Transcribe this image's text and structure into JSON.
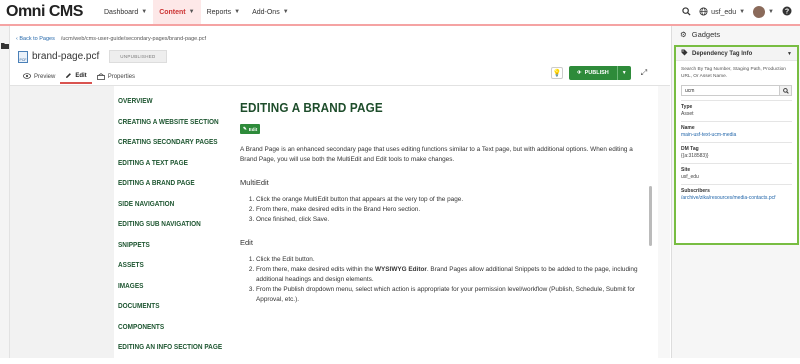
{
  "app": {
    "logo": "Omni CMS"
  },
  "nav": [
    {
      "label": "Dashboard",
      "active": false
    },
    {
      "label": "Content",
      "active": true
    },
    {
      "label": "Reports",
      "active": false
    },
    {
      "label": "Add-Ons",
      "active": false
    }
  ],
  "topright": {
    "site": "usf_edu"
  },
  "breadcrumb": {
    "back": "Back to Pages",
    "path": "/ucm/web/cms-user-guide/secondary-pages/brand-page.pcf"
  },
  "file": {
    "icon_text": "PCF",
    "name": "brand-page.pcf",
    "status": "UNPUBLISHED"
  },
  "tabs": [
    {
      "label": "Preview",
      "icon": "eye-icon"
    },
    {
      "label": "Edit",
      "icon": "pencil-icon"
    },
    {
      "label": "Properties",
      "icon": "properties-icon"
    }
  ],
  "toolbar": {
    "publish": "PUBLISH"
  },
  "sidenav": [
    "Overview",
    "Creating a Website Section",
    "Creating Secondary Pages",
    "Editing a Text Page",
    "Editing a Brand Page",
    "Side Navigation",
    "Editing Sub Navigation",
    "Snippets",
    "Assets",
    "Images",
    "Documents",
    "Components",
    "Editing an Info Section Page"
  ],
  "content": {
    "title": "EDITING A BRAND PAGE",
    "edit_button": "Edit",
    "intro": "A Brand Page is an enhanced secondary page that uses editing functions similar to a Text page, but with additional options. When editing a Brand Page, you will use both the MultiEdit and Edit tools to make changes.",
    "s1_title": "MultiEdit",
    "s1_items": [
      "Click the orange MultiEdit button that appears at the very top of the page.",
      "From there, make desired edits in the Brand Hero section.",
      "Once finished, click Save."
    ],
    "s2_title": "Edit",
    "s2_item1": "Click the Edit button.",
    "s2_item2_pre": "From there, make desired edits within the ",
    "s2_item2_bold": "WYSIWYG Editor",
    "s2_item2_post": ". Brand Pages allow additional Snippets to be added to the page, including additional headings and design elements.",
    "s2_item3": "From the Publish dropdown menu, select which action is appropriate for your permission level/workflow (Publish, Schedule, Submit for Approval, etc.)."
  },
  "gadgets": {
    "title": "Gadgets",
    "panel_title": "Dependency Tag Info",
    "help": "Search By Tag Number, Staging Path, Production URL, Or Asset Name.",
    "search_value": "ucm",
    "fields": [
      {
        "label": "Type",
        "value": "Asset",
        "link": false
      },
      {
        "label": "Name",
        "value": "main-usf-text-ucm-media",
        "link": true
      },
      {
        "label": "DM Tag",
        "value": "{{a:318583}}",
        "link": false
      },
      {
        "label": "Site",
        "value": "usf_edu",
        "link": false
      },
      {
        "label": "Subscribers",
        "value": "/archive/zika/resources/media-contacts.pcf",
        "link": true
      }
    ]
  }
}
